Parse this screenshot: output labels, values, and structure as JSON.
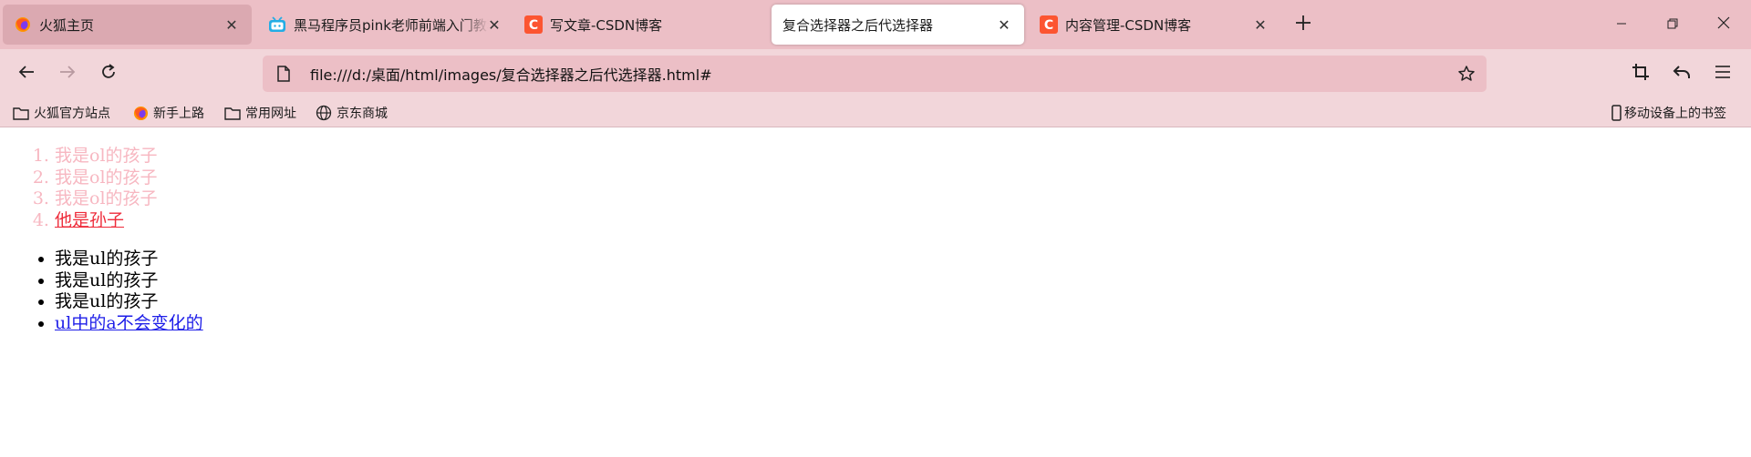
{
  "browser": {
    "tabs": [
      {
        "title": "火狐主页",
        "icon": "firefox-icon",
        "state": "first"
      },
      {
        "title": "黑马程序员pink老师前端入门教程",
        "icon": "bilibili-icon",
        "state": "inactive"
      },
      {
        "title": "写文章-CSDN博客",
        "icon": "csdn-icon",
        "state": "inactive"
      },
      {
        "title": "复合选择器之后代选择器",
        "icon": "none",
        "state": "active"
      },
      {
        "title": "内容管理-CSDN博客",
        "icon": "csdn-icon",
        "state": "inactive"
      }
    ],
    "url": "file:///d:/桌面/html/images/复合选择器之后代选择器.html#",
    "bookmarks": [
      {
        "label": "火狐官方站点",
        "icon": "folder-icon"
      },
      {
        "label": "新手上路",
        "icon": "firefox-icon"
      },
      {
        "label": "常用网址",
        "icon": "folder-icon"
      },
      {
        "label": "京东商城",
        "icon": "globe-icon"
      }
    ],
    "mobile_bookmarks": "移动设备上的书签",
    "colors": {
      "tabstrip": "#ecbfc6",
      "toolbar": "#f2d6da",
      "active_tab": "#ffffff",
      "csdn_red": "#fc5531"
    }
  },
  "page": {
    "ol_items": [
      "我是ol的孩子",
      "我是ol的孩子",
      "我是ol的孩子"
    ],
    "ol_link": "他是孙子",
    "ul_items": [
      "我是ul的孩子",
      "我是ul的孩子",
      "我是ul的孩子"
    ],
    "ul_link": "ul中的a不会变化的",
    "colors": {
      "ol_text": "#f7b7c1",
      "ol_link": "#ee2b3a",
      "ul_text": "#000000",
      "ul_link": "#1e1ee8"
    }
  }
}
